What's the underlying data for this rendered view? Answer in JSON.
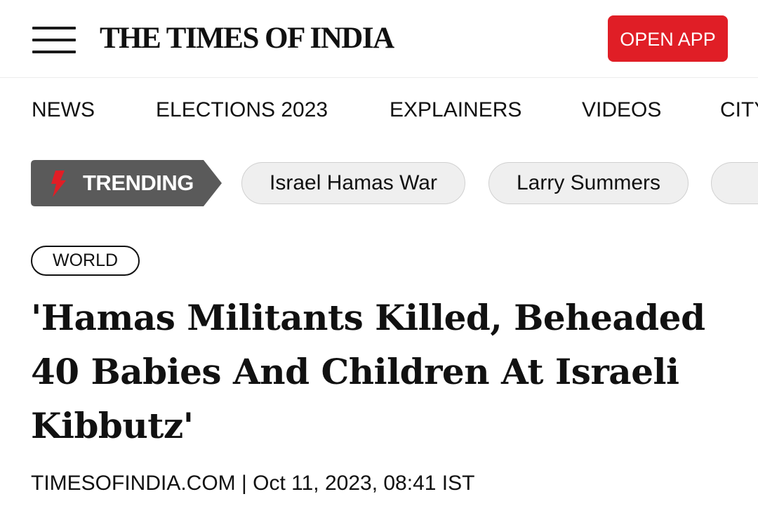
{
  "header": {
    "logo_text": "THE TIMES OF INDIA",
    "open_app_label": "OPEN APP"
  },
  "nav": {
    "items": [
      {
        "label": "NEWS"
      },
      {
        "label": "ELECTIONS 2023"
      },
      {
        "label": "EXPLAINERS"
      },
      {
        "label": "VIDEOS"
      },
      {
        "label": "CITY"
      }
    ]
  },
  "trending": {
    "label": "TRENDING",
    "chips": [
      {
        "label": "Israel Hamas War"
      },
      {
        "label": "Larry Summers"
      },
      {
        "label": ""
      }
    ]
  },
  "article": {
    "section": "WORLD",
    "headline": "'Hamas Militants Killed, Beheaded 40 Babies And Children At Israeli Kibbutz'",
    "source": "TIMESOFINDIA.COM",
    "separator": " | ",
    "date": "Oct 11, 2023, 08:41 IST"
  },
  "colors": {
    "brand_red": "#e01e26",
    "trending_bg": "#5a5a5a",
    "chip_bg": "#efefef",
    "text": "#111111"
  },
  "icons": {
    "menu": "hamburger-menu-icon",
    "trending": "lightning-bolt-icon"
  }
}
